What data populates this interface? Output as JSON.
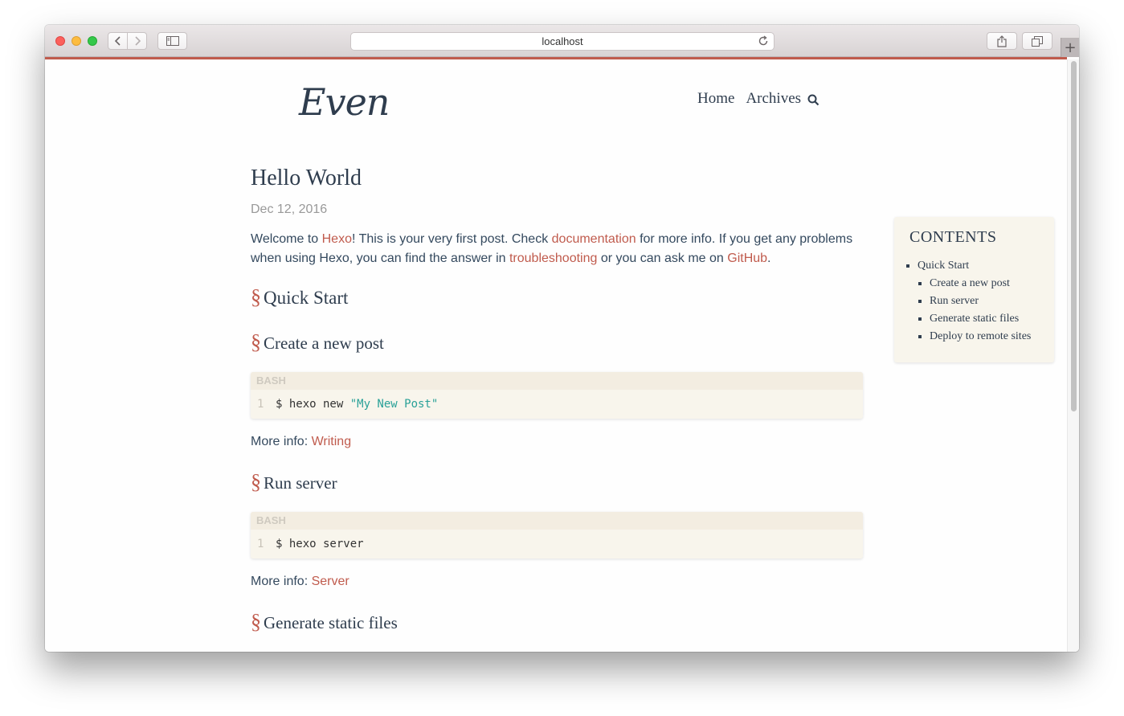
{
  "browser": {
    "address": "localhost",
    "accent_color": "#c05b4d",
    "icons": [
      "back-icon",
      "forward-icon",
      "sidebar-icon",
      "reload-icon",
      "share-icon",
      "tabs-icon",
      "plus-icon"
    ]
  },
  "site": {
    "logo": "Even",
    "nav": [
      {
        "label": "Home"
      },
      {
        "label": "Archives"
      }
    ]
  },
  "post": {
    "title": "Hello World",
    "date": "Dec 12, 2016",
    "intro": {
      "t1": "Welcome to ",
      "l1": "Hexo",
      "t2": "! This is your very first post. Check ",
      "l2": "documentation",
      "t3": " for more info. If you get any problems when using Hexo, you can find the answer in ",
      "l3": "troubleshooting",
      "t4": " or you can ask me on ",
      "l4": "GitHub",
      "t5": "."
    },
    "section_mark": "§",
    "quick_start": "Quick Start",
    "create_post": {
      "heading": "Create a new post",
      "lang": "BASH",
      "line_no": "1",
      "code_cmd": "$ hexo new ",
      "code_str": "\"My New Post\"",
      "more_label": "More info: ",
      "more_link": "Writing"
    },
    "run_server": {
      "heading": "Run server",
      "lang": "BASH",
      "line_no": "1",
      "code_cmd": "$ hexo server",
      "more_label": "More info: ",
      "more_link": "Server"
    },
    "generate": {
      "heading": "Generate static files"
    }
  },
  "toc": {
    "title": "CONTENTS",
    "top": "Quick Start",
    "items": [
      "Create a new post",
      "Run server",
      "Generate static files",
      "Deploy to remote sites"
    ]
  }
}
